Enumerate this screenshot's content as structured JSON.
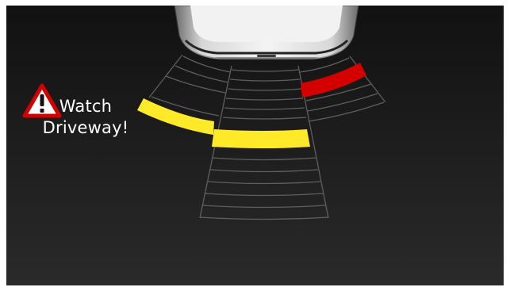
{
  "warning": {
    "line1": "Watch",
    "line2": "Driveway!",
    "icon": "warning-triangle-icon",
    "icon_color": "#d40000"
  },
  "sensors": {
    "colors": {
      "grid": "#666666",
      "yellow": "#ffea2a",
      "red": "#d40000"
    },
    "left": {
      "level": "near",
      "color": "yellow"
    },
    "center": {
      "level": "near",
      "color": "yellow"
    },
    "right": {
      "level": "very-near",
      "color": "red"
    }
  }
}
